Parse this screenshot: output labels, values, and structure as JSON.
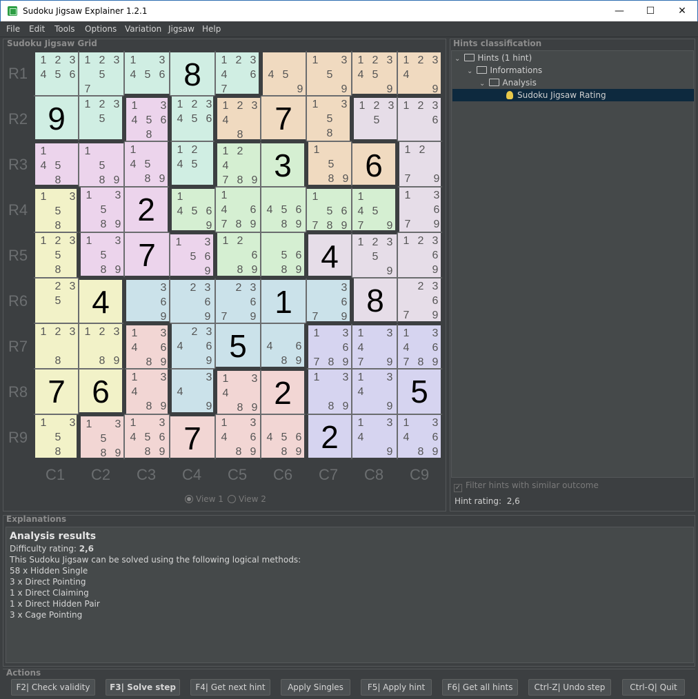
{
  "window": {
    "title": "Sudoku Jigsaw Explainer 1.2.1",
    "minimize": "—",
    "maximize": "☐",
    "close": "✕"
  },
  "menu": [
    "File",
    "Edit",
    "Tools",
    "Options",
    "Variation",
    "Jigsaw",
    "Help"
  ],
  "grid_panel": {
    "title": "Sudoku Jigsaw Grid",
    "rows": [
      "R1",
      "R2",
      "R3",
      "R4",
      "R5",
      "R6",
      "R7",
      "R8",
      "R9"
    ],
    "cols": [
      "C1",
      "C2",
      "C3",
      "C4",
      "C5",
      "C6",
      "C7",
      "C8",
      "C9"
    ],
    "view1": "View 1",
    "view2": "View 2",
    "region_colors": {
      "A": "#d0eee3",
      "B": "#f0dac0",
      "C": "#e6dde8",
      "D": "#ecd4ec",
      "E": "#d5efd2",
      "F": "#f2f2c8",
      "G": "#cbe2ea",
      "H": "#f2d6d4",
      "I": "#d6d4f0"
    },
    "regions": [
      "AAAAABBBB",
      "AADABBBCC",
      "DDDAEEBBC",
      "FDDEEEEEC",
      "FDDDEECCC",
      "FFGGGGGCC",
      "FFHGGGIII",
      "FFHGHHIII",
      "FHHHHHIII"
    ],
    "cells": [
      [
        [
          1,
          2,
          3,
          4,
          5,
          6
        ],
        [
          1,
          2,
          3,
          5,
          7
        ],
        [
          1,
          3,
          4,
          5,
          6
        ],
        "8",
        [
          1,
          2,
          3,
          4,
          6,
          7
        ],
        [
          4,
          5,
          9
        ],
        [
          1,
          3,
          5,
          9
        ],
        [
          1,
          2,
          3,
          4,
          5,
          9
        ],
        [
          1,
          2,
          3,
          4,
          9
        ]
      ],
      [
        "9",
        [
          1,
          2,
          3,
          5
        ],
        [
          1,
          3,
          4,
          5,
          6,
          8
        ],
        [
          1,
          2,
          3,
          4,
          5,
          6
        ],
        [
          1,
          2,
          3,
          4,
          8
        ],
        "7",
        [
          1,
          3,
          5,
          8
        ],
        [
          1,
          2,
          3,
          5
        ],
        [
          1,
          2,
          3,
          6
        ]
      ],
      [
        [
          1,
          4,
          5,
          8
        ],
        [
          1,
          5,
          8,
          9
        ],
        [
          1,
          4,
          5,
          8,
          9
        ],
        [
          1,
          2,
          4,
          5
        ],
        [
          1,
          2,
          4,
          7,
          8,
          9
        ],
        "3",
        [
          1,
          5,
          8,
          9
        ],
        "6",
        [
          1,
          2,
          7,
          9
        ]
      ],
      [
        [
          1,
          3,
          5,
          8
        ],
        [
          1,
          3,
          5,
          8,
          9
        ],
        "2",
        [
          1,
          4,
          5,
          6,
          9
        ],
        [
          1,
          4,
          6,
          7,
          8,
          9
        ],
        [
          4,
          5,
          6,
          8,
          9
        ],
        [
          1,
          5,
          6,
          7,
          8,
          9
        ],
        [
          1,
          4,
          5,
          7,
          9
        ],
        [
          1,
          3,
          6,
          7,
          9
        ]
      ],
      [
        [
          1,
          2,
          3,
          5,
          8
        ],
        [
          1,
          3,
          5,
          8,
          9
        ],
        "7",
        [
          1,
          3,
          5,
          6,
          9
        ],
        [
          1,
          2,
          6,
          8,
          9
        ],
        [
          5,
          6,
          8,
          9
        ],
        "4",
        [
          1,
          2,
          3,
          5,
          9
        ],
        [
          1,
          2,
          3,
          6,
          9
        ]
      ],
      [
        [
          2,
          3,
          5
        ],
        "4",
        [
          3,
          6,
          9
        ],
        [
          2,
          3,
          6,
          9
        ],
        [
          2,
          3,
          6,
          7,
          9
        ],
        "1",
        [
          3,
          6,
          7,
          9
        ],
        "8",
        [
          2,
          3,
          6,
          7,
          9
        ]
      ],
      [
        [
          1,
          2,
          3,
          8
        ],
        [
          1,
          2,
          3,
          8,
          9
        ],
        [
          1,
          3,
          4,
          6,
          8,
          9
        ],
        [
          2,
          3,
          4,
          6,
          9
        ],
        "5",
        [
          4,
          6,
          8,
          9
        ],
        [
          1,
          3,
          6,
          7,
          8,
          9
        ],
        [
          1,
          3,
          4,
          7,
          9
        ],
        [
          1,
          3,
          4,
          6,
          7,
          8,
          9
        ]
      ],
      [
        "7",
        "6",
        [
          1,
          3,
          4,
          8,
          9
        ],
        [
          3,
          4,
          9
        ],
        [
          1,
          3,
          4,
          8,
          9
        ],
        "2",
        [
          1,
          3,
          8,
          9
        ],
        [
          1,
          3,
          4,
          9
        ],
        "5"
      ],
      [
        [
          1,
          3,
          5,
          8
        ],
        [
          1,
          3,
          5,
          8,
          9
        ],
        [
          1,
          3,
          4,
          5,
          6,
          8,
          9
        ],
        "7",
        [
          1,
          3,
          4,
          6,
          8,
          9
        ],
        [
          4,
          5,
          6,
          8,
          9
        ],
        "2",
        [
          1,
          3,
          4,
          9
        ],
        [
          1,
          3,
          4,
          6,
          8,
          9
        ]
      ]
    ]
  },
  "hints_panel": {
    "title": "Hints classification",
    "tree": [
      "Hints (1 hint)",
      "Informations",
      "Analysis",
      "Sudoku Jigsaw Rating"
    ],
    "filter": "Filter hints with similar outcome",
    "rating_label": "Hint rating:",
    "rating_value": "2,6"
  },
  "explanations": {
    "title": "Explanations",
    "heading": "Analysis results",
    "difficulty_label": "Difficulty rating: ",
    "difficulty_value": "2,6",
    "intro": "This Sudoku Jigsaw can be solved using the following logical methods:",
    "methods": [
      "58 x Hidden Single",
      "3 x Direct Pointing",
      "1 x Direct Claiming",
      "1 x Direct Hidden Pair",
      "3 x Cage Pointing"
    ]
  },
  "actions": {
    "title": "Actions",
    "buttons": [
      "F2| Check validity",
      "F3| Solve step",
      "F4| Get next hint",
      "Apply Singles",
      "F5| Apply hint",
      "F6| Get all hints",
      "Ctrl-Z| Undo step",
      "Ctrl-Q| Quit"
    ]
  }
}
